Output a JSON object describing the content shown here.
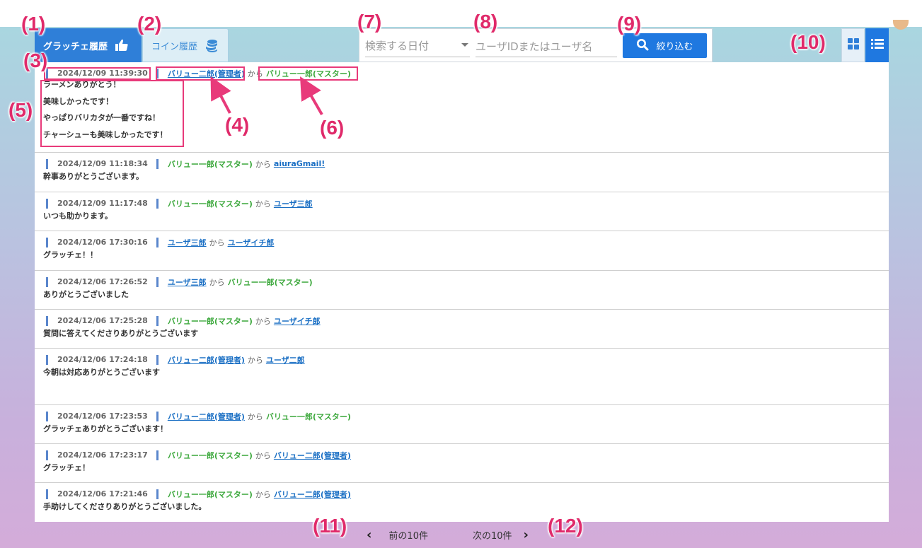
{
  "tabs": {
    "gratche_label": "グラッチェ履歴",
    "coin_label": "コイン履歴"
  },
  "search": {
    "date_placeholder": "検索する日付",
    "user_placeholder": "ユーザIDまたはユーザ名",
    "filter_label": "絞り込む"
  },
  "entries": [
    {
      "timestamp": "2024/12/09 11:39:30",
      "sender": "バリュー二郎(管理者)",
      "kara": "から",
      "receiver": "バリュー一郎(マスター)",
      "messages": [
        "ラーメンありがとう！",
        "美味しかったです！",
        "やっぱりバリカタが一番ですね！",
        "チャーシューも美味しかったです！"
      ]
    },
    {
      "timestamp": "2024/12/09 11:18:34",
      "sender": "バリュー一郎(マスター)",
      "kara": "から",
      "receiver": "aiuraGmail!",
      "messages": [
        "幹事ありがとうございます。"
      ]
    },
    {
      "timestamp": "2024/12/09 11:17:48",
      "sender": "バリュー一郎(マスター)",
      "kara": "から",
      "receiver": "ユーザ三郎",
      "messages": [
        "いつも助かります。"
      ]
    },
    {
      "timestamp": "2024/12/06 17:30:16",
      "sender": "ユーザ三郎",
      "kara": "から",
      "receiver": "ユーザイチ郎",
      "messages": [
        "グラッチェ！！"
      ]
    },
    {
      "timestamp": "2024/12/06 17:26:52",
      "sender": "ユーザ三郎",
      "kara": "から",
      "receiver": "バリュー一郎(マスター)",
      "messages": [
        "ありがとうございました"
      ]
    },
    {
      "timestamp": "2024/12/06 17:25:28",
      "sender": "バリュー一郎(マスター)",
      "kara": "から",
      "receiver": "ユーザイチ郎",
      "messages": [
        "質問に答えてくださりありがとうございます"
      ]
    },
    {
      "timestamp": "2024/12/06 17:24:18",
      "sender": "バリュー二郎(管理者)",
      "kara": "から",
      "receiver": "ユーザ二郎",
      "messages": [
        "今朝は対応ありがとうございます"
      ]
    },
    {
      "timestamp": "2024/12/06 17:23:53",
      "sender": "バリュー二郎(管理者)",
      "kara": "から",
      "receiver": "バリュー一郎(マスター)",
      "messages": [
        "グラッチェありがとうございます！"
      ]
    },
    {
      "timestamp": "2024/12/06 17:23:17",
      "sender": "バリュー一郎(マスター)",
      "kara": "から",
      "receiver": "バリュー二郎(管理者)",
      "messages": [
        "グラッチェ！"
      ]
    },
    {
      "timestamp": "2024/12/06 17:21:46",
      "sender": "バリュー一郎(マスター)",
      "kara": "から",
      "receiver": "バリュー二郎(管理者)",
      "messages": [
        "手助けしてくださりありがとうございました。"
      ]
    }
  ],
  "pagination": {
    "prev_label": "前の10件",
    "next_label": "次の10件"
  },
  "annotations": [
    "(1)",
    "(2)",
    "(3)",
    "(4)",
    "(5)",
    "(6)",
    "(7)",
    "(8)",
    "(9)",
    "(10)",
    "(11)",
    "(12)"
  ],
  "colors": {
    "primary": "#1f78e0",
    "link_blue": "#1a6fc4",
    "master_green": "#3ca83c",
    "annotation_pink": "#e02a6a"
  }
}
